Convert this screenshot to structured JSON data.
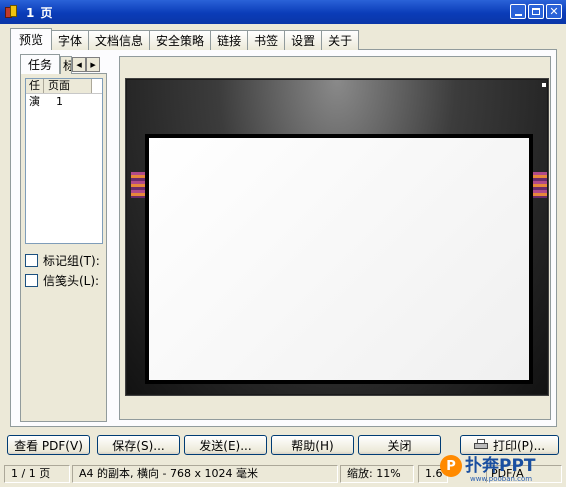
{
  "window": {
    "title": "1 页"
  },
  "tabs": [
    "预览",
    "字体",
    "文档信息",
    "安全策略",
    "链接",
    "书签",
    "设置",
    "关于"
  ],
  "left_panel": {
    "subtabs": {
      "task": "任务",
      "partial": "标"
    },
    "list": {
      "headers": [
        "任",
        "页面"
      ],
      "rows": [
        {
          "c1": "演",
          "c2": "1"
        }
      ]
    },
    "checkboxes": [
      "标记组(T):",
      "信笺头(L):"
    ]
  },
  "buttons": {
    "view_pdf": "查看 PDF(V)",
    "save": "保存(S)...",
    "send": "发送(E)...",
    "help": "帮助(H)",
    "close": "关闭",
    "print": "打印(P)..."
  },
  "status": {
    "page": "1 / 1 页",
    "paper": "A4 的副本, 横向 - 768 x 1024 毫米",
    "zoom": "缩放: 11%",
    "version": "1.6",
    "pdf_tag": "PDF/A"
  },
  "watermark": {
    "brand": "扑奔PPT",
    "sub": "www.pooban.com"
  }
}
